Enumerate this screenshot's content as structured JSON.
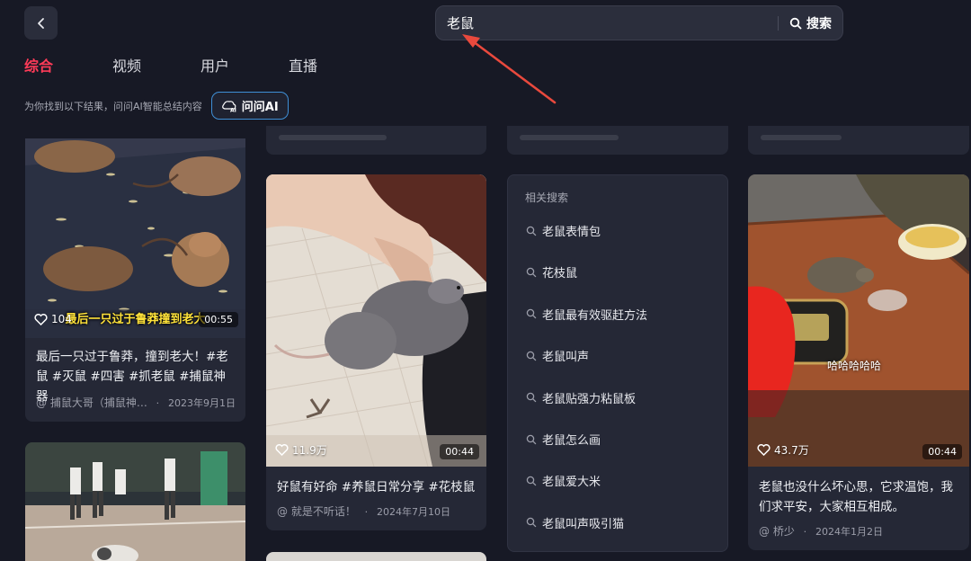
{
  "header": {
    "search_value": "老鼠",
    "search_button_label": "搜索"
  },
  "tabs": [
    {
      "label": "综合",
      "active": true
    },
    {
      "label": "视频",
      "active": false
    },
    {
      "label": "用户",
      "active": false
    },
    {
      "label": "直播",
      "active": false
    }
  ],
  "ai": {
    "hint": "为你找到以下结果，问问AI智能总结内容",
    "button_label": "问问AI"
  },
  "cards": [
    {
      "likes": "104",
      "duration": "00:55",
      "caption_overlay": "最后一只过于鲁莽撞到老大",
      "title": "最后一只过于鲁莽，撞到老大！#老鼠 #灭鼠 #四害 #抓老鼠 #捕鼠神器",
      "author": "@ 捕鼠大哥（捕鼠神…",
      "date": "2023年9月1日"
    },
    {
      "likes": "11.9万",
      "duration": "00:44",
      "title": "好鼠有好命 #养鼠日常分享 #花枝鼠",
      "author": "@ 就是不听话！",
      "date": "2024年7月10日"
    },
    {
      "likes": "43.7万",
      "duration": "00:44",
      "caption_overlay": "哈哈哈哈哈",
      "title": "老鼠也没什么坏心思，它求温饱，我们求平安，大家相互相成。",
      "author": "@ 桥少",
      "date": "2024年1月2日"
    }
  ],
  "related": {
    "heading": "相关搜索",
    "items": [
      "老鼠表情包",
      "花枝鼠",
      "老鼠最有效驱赶方法",
      "老鼠叫声",
      "老鼠贴强力粘鼠板",
      "老鼠怎么画",
      "老鼠爱大米",
      "老鼠叫声吸引猫"
    ]
  },
  "colors": {
    "background": "#171925",
    "card": "#252836",
    "accent_tab": "#ff3b58",
    "ai_border": "#3f8fd6",
    "annotation_arrow": "#e9493d"
  }
}
